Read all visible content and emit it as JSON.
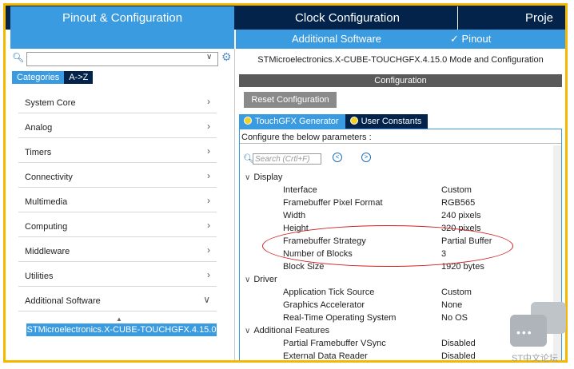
{
  "topnav": {
    "pinout_tab": "Pinout & Configuration",
    "clock_tab": "Clock Configuration",
    "project_tab": "Proje"
  },
  "subnav": {
    "additional_software": "Additional Software",
    "pinout": "✓ Pinout"
  },
  "left": {
    "search_placeholder": "",
    "tabs": [
      "Categories",
      "A->Z"
    ],
    "categories": [
      {
        "label": "System Core",
        "chevron": "›"
      },
      {
        "label": "Analog",
        "chevron": "›"
      },
      {
        "label": "Timers",
        "chevron": "›"
      },
      {
        "label": "Connectivity",
        "chevron": "›"
      },
      {
        "label": "Multimedia",
        "chevron": "›"
      },
      {
        "label": "Computing",
        "chevron": "›"
      },
      {
        "label": "Middleware",
        "chevron": "›"
      },
      {
        "label": "Utilities",
        "chevron": "›"
      },
      {
        "label": "Additional Software",
        "chevron": "∨"
      }
    ],
    "selected_item": "STMicroelectronics.X-CUBE-TOUCHGFX.4.15.0"
  },
  "right": {
    "mode_title": "STMicroelectronics.X-CUBE-TOUCHGFX.4.15.0 Mode and Configuration",
    "configuration_bar": "Configuration",
    "reset_button": "Reset Configuration",
    "tabs": [
      "TouchGFX Generator",
      "User Constants"
    ],
    "configure_header": "Configure the below parameters :",
    "search_placeholder": "Search (Crtl+F)",
    "groups": {
      "display": "Display",
      "driver": "Driver",
      "additional": "Additional Features"
    },
    "params": [
      {
        "key": "Interface",
        "value": "Custom"
      },
      {
        "key": "Framebuffer Pixel Format",
        "value": "RGB565"
      },
      {
        "key": "Width",
        "value": "240 pixels"
      },
      {
        "key": "Height",
        "value": "320 pixels"
      },
      {
        "key": "Framebuffer Strategy",
        "value": "Partial Buffer"
      },
      {
        "key": "Number of Blocks",
        "value": "3"
      },
      {
        "key": "Block Size",
        "value": "1920 bytes"
      },
      {
        "key": "Application Tick Source",
        "value": "Custom"
      },
      {
        "key": "Graphics Accelerator",
        "value": "None"
      },
      {
        "key": "Real-Time Operating System",
        "value": "No OS"
      },
      {
        "key": "Partial Framebuffer VSync",
        "value": "Disabled"
      },
      {
        "key": "External Data Reader",
        "value": "Disabled"
      }
    ]
  },
  "watermark": "ST中文论坛",
  "colors": {
    "accent_blue": "#3a9be0",
    "dark_navy": "#03234b",
    "highlight_frame": "#f5b800",
    "annotation_ellipse": "#d02020"
  }
}
